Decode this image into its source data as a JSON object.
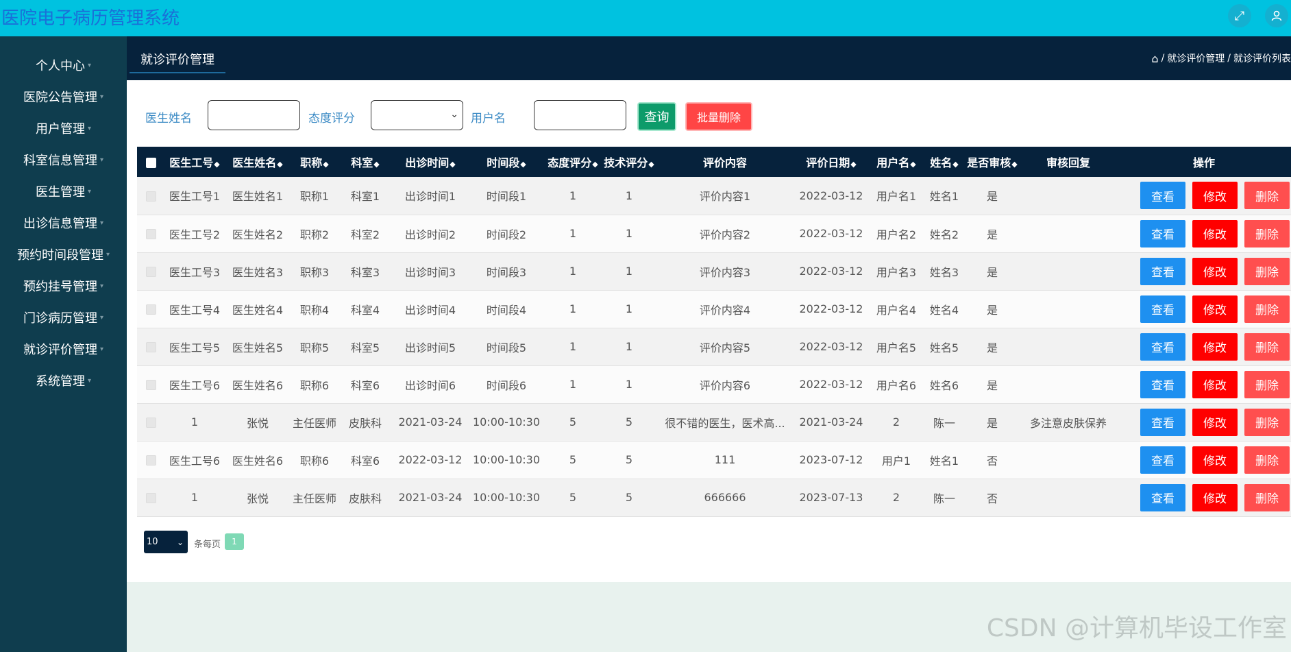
{
  "app": {
    "title": "医院电子病历管理系统"
  },
  "header": {
    "icons": [
      "fullscreen-icon",
      "user-icon"
    ]
  },
  "sidebar": {
    "items": [
      {
        "label": "个人中心"
      },
      {
        "label": "医院公告管理"
      },
      {
        "label": "用户管理"
      },
      {
        "label": "科室信息管理"
      },
      {
        "label": "医生管理"
      },
      {
        "label": "出诊信息管理"
      },
      {
        "label": "预约时间段管理"
      },
      {
        "label": "预约挂号管理"
      },
      {
        "label": "门诊病历管理"
      },
      {
        "label": "就诊评价管理"
      },
      {
        "label": "系统管理"
      }
    ]
  },
  "subheader": {
    "tab": "就诊评价管理",
    "breadcrumb": [
      "就诊评价管理",
      "就诊评价列表"
    ]
  },
  "search": {
    "doctor_name_label": "医生姓名",
    "doctor_name_value": "",
    "attitude_label": "态度评分",
    "attitude_value": "",
    "username_label": "用户名",
    "username_value": "",
    "query_button": "查询",
    "batch_delete_button": "批量删除"
  },
  "table": {
    "columns": [
      "医生工号",
      "医生姓名",
      "职称",
      "科室",
      "出诊时间",
      "时间段",
      "态度评分",
      "技术评分",
      "评价内容",
      "评价日期",
      "用户名",
      "姓名",
      "是否审核",
      "审核回复",
      "操作"
    ],
    "sortable": [
      true,
      true,
      true,
      true,
      true,
      true,
      true,
      true,
      false,
      true,
      true,
      true,
      true,
      false,
      false
    ],
    "actions": {
      "view": "查看",
      "edit": "修改",
      "delete": "删除"
    },
    "rows": [
      [
        "医生工号1",
        "医生姓名1",
        "职称1",
        "科室1",
        "出诊时间1",
        "时间段1",
        "1",
        "1",
        "评价内容1",
        "2022-03-12",
        "用户名1",
        "姓名1",
        "是",
        ""
      ],
      [
        "医生工号2",
        "医生姓名2",
        "职称2",
        "科室2",
        "出诊时间2",
        "时间段2",
        "1",
        "1",
        "评价内容2",
        "2022-03-12",
        "用户名2",
        "姓名2",
        "是",
        ""
      ],
      [
        "医生工号3",
        "医生姓名3",
        "职称3",
        "科室3",
        "出诊时间3",
        "时间段3",
        "1",
        "1",
        "评价内容3",
        "2022-03-12",
        "用户名3",
        "姓名3",
        "是",
        ""
      ],
      [
        "医生工号4",
        "医生姓名4",
        "职称4",
        "科室4",
        "出诊时间4",
        "时间段4",
        "1",
        "1",
        "评价内容4",
        "2022-03-12",
        "用户名4",
        "姓名4",
        "是",
        ""
      ],
      [
        "医生工号5",
        "医生姓名5",
        "职称5",
        "科室5",
        "出诊时间5",
        "时间段5",
        "1",
        "1",
        "评价内容5",
        "2022-03-12",
        "用户名5",
        "姓名5",
        "是",
        ""
      ],
      [
        "医生工号6",
        "医生姓名6",
        "职称6",
        "科室6",
        "出诊时间6",
        "时间段6",
        "1",
        "1",
        "评价内容6",
        "2022-03-12",
        "用户名6",
        "姓名6",
        "是",
        ""
      ],
      [
        "1",
        "张悦",
        "主任医师",
        "皮肤科",
        "2021-03-24",
        "10:00-10:30",
        "5",
        "5",
        "很不错的医生，医术高...",
        "2021-03-24",
        "2",
        "陈一",
        "是",
        "多注意皮肤保养"
      ],
      [
        "医生工号6",
        "医生姓名6",
        "职称6",
        "科室6",
        "2022-03-12",
        "10:00-10:30",
        "5",
        "5",
        "111",
        "2023-07-12",
        "用户1",
        "姓名1",
        "否",
        ""
      ],
      [
        "1",
        "张悦",
        "主任医师",
        "皮肤科",
        "2021-03-24",
        "10:00-10:30",
        "5",
        "5",
        "666666",
        "2023-07-13",
        "2",
        "陈一",
        "否",
        ""
      ]
    ]
  },
  "pagination": {
    "page_size": "10",
    "per_page_label": "条每页",
    "current_page": "1"
  },
  "watermark": "CSDN @计算机毕设工作室",
  "colors": {
    "header": "#00c2e0",
    "sidebar": "#0f3d4e",
    "dark": "#06223c",
    "view": "#1e90f0",
    "edit": "#ff0000",
    "delete": "#ff4f4f",
    "query": "#0d9b6a"
  }
}
